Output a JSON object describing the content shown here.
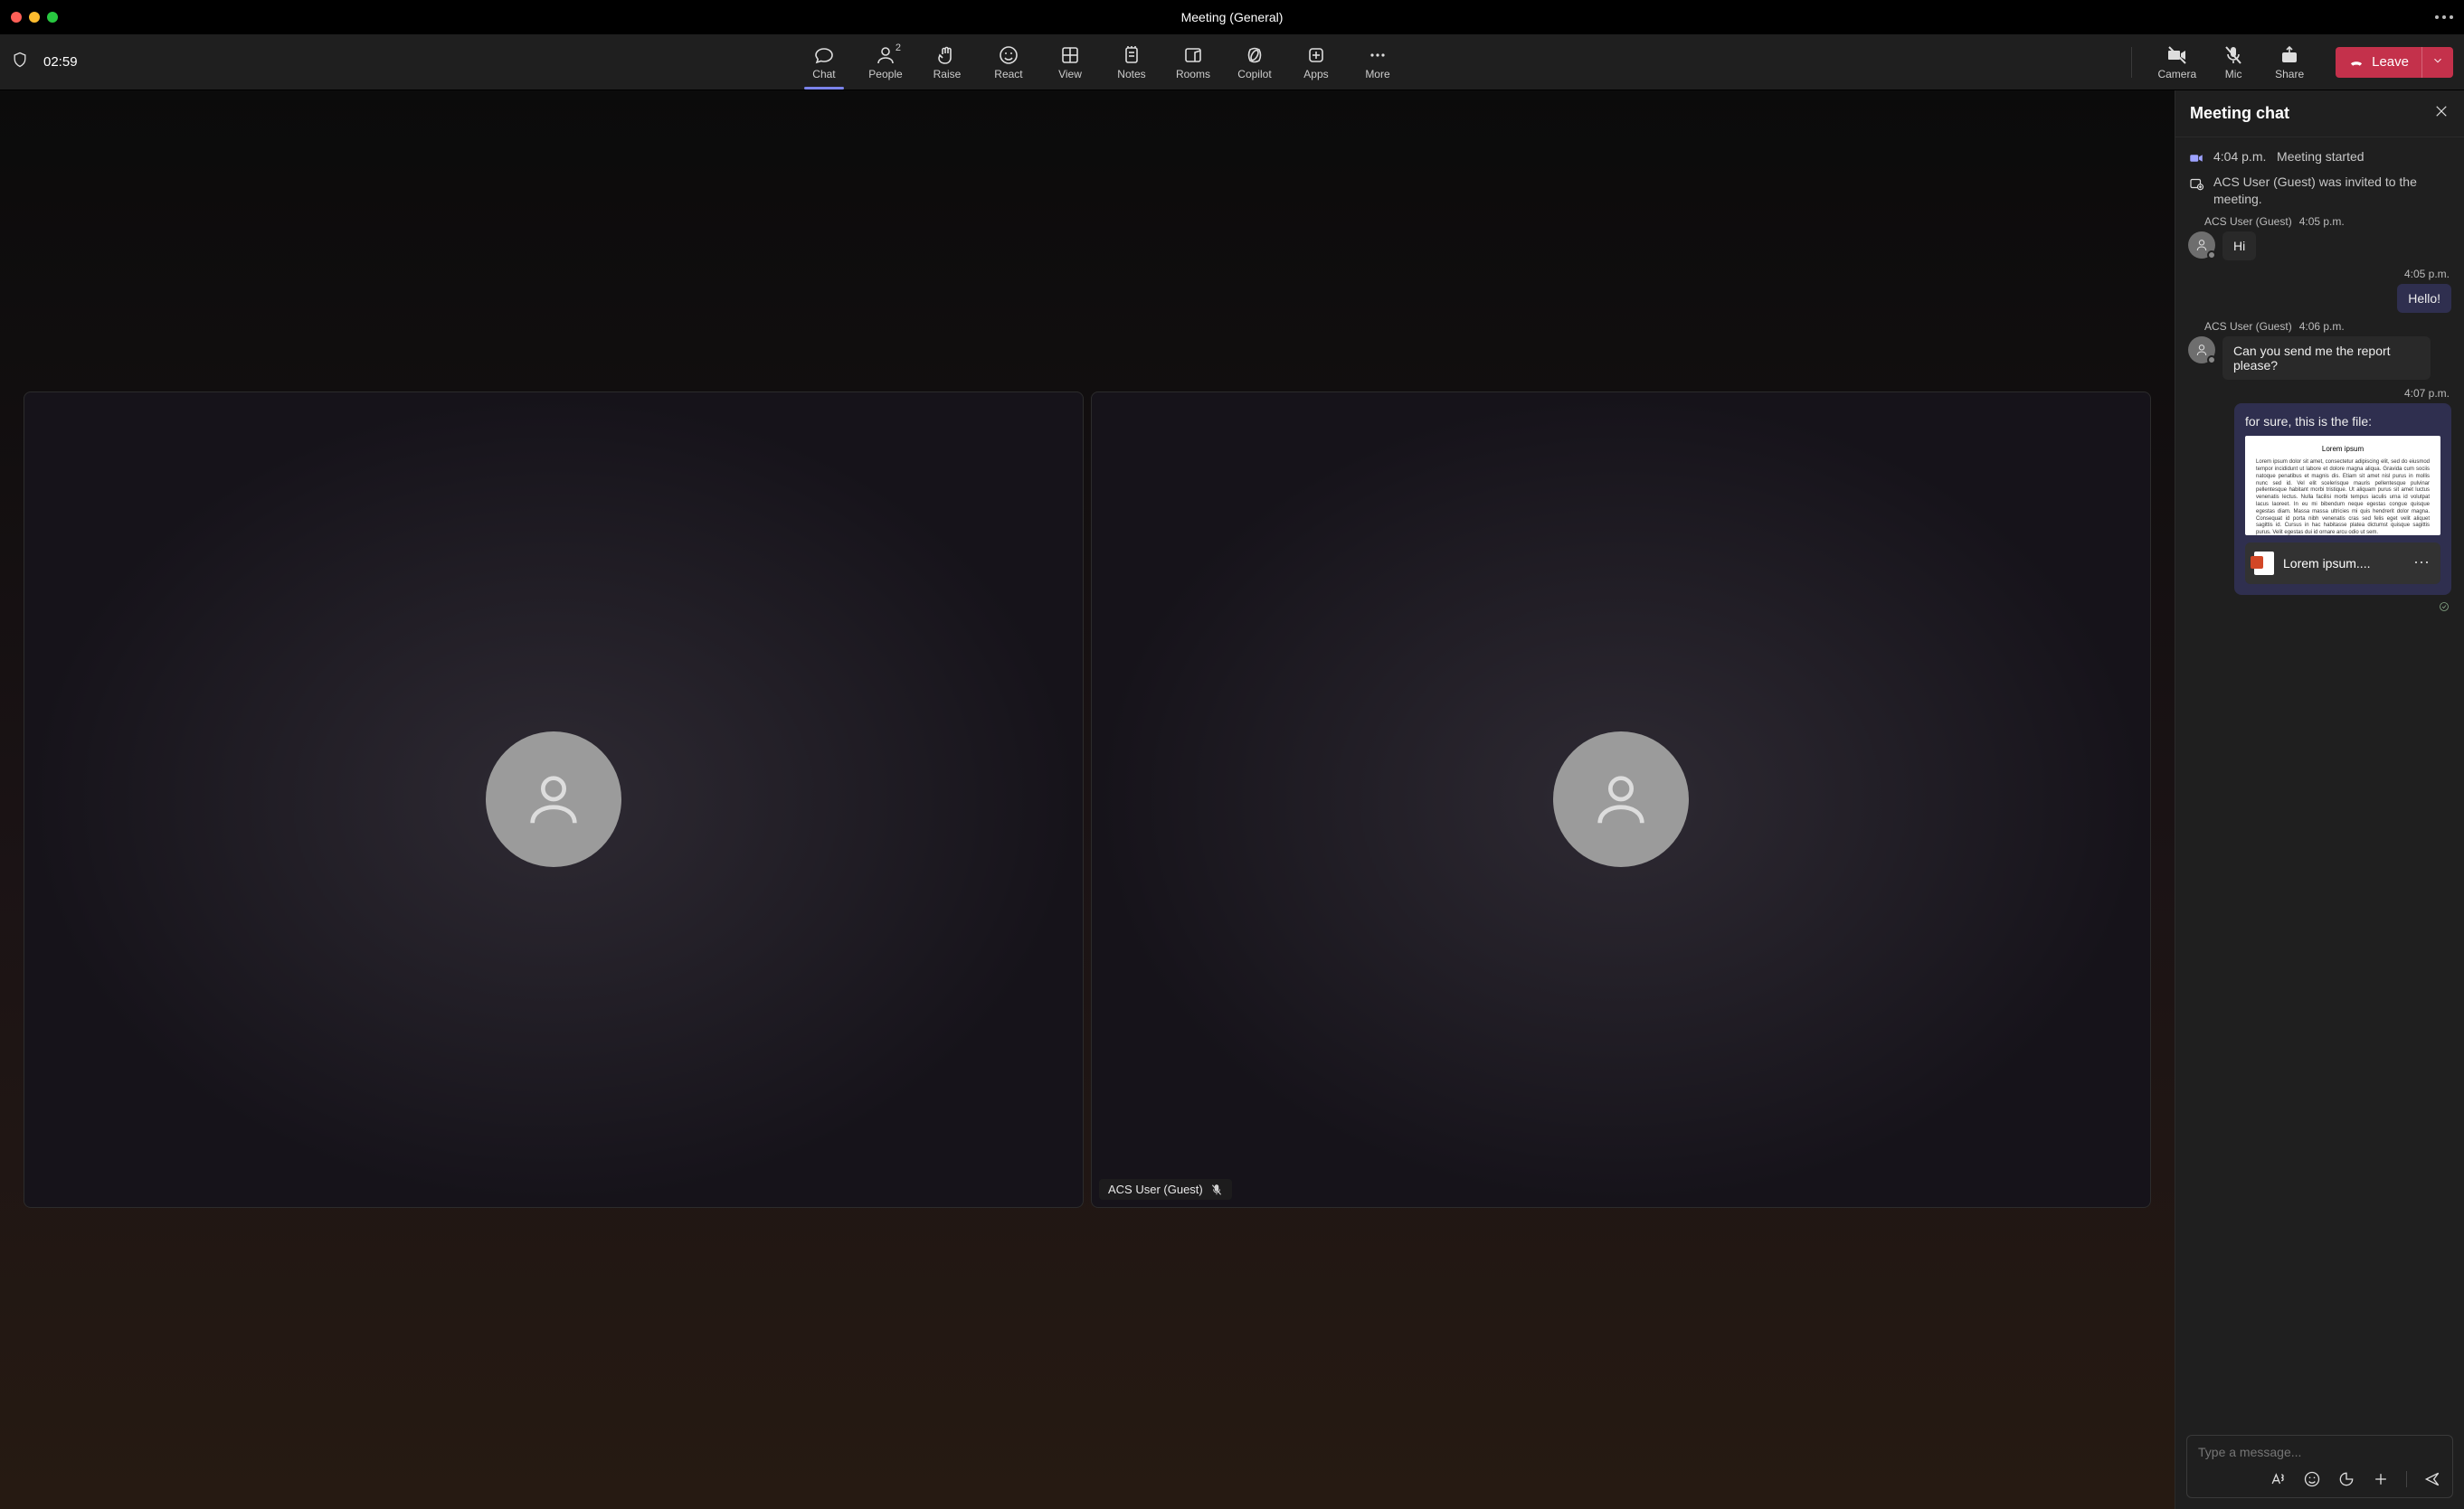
{
  "titlebar": {
    "title": "Meeting (General)"
  },
  "toolbar": {
    "timer": "02:59",
    "items": {
      "chat": "Chat",
      "people": "People",
      "people_count": "2",
      "raise": "Raise",
      "react": "React",
      "view": "View",
      "notes": "Notes",
      "rooms": "Rooms",
      "copilot": "Copilot",
      "apps": "Apps",
      "more": "More",
      "camera": "Camera",
      "mic": "Mic",
      "share": "Share"
    },
    "leave": "Leave"
  },
  "stage": {
    "participant2_name": "ACS User (Guest)"
  },
  "chat": {
    "title": "Meeting chat",
    "system_meeting_started_time": "4:04 p.m.",
    "system_meeting_started_text": "Meeting started",
    "system_invited_text": "ACS User (Guest) was invited to the meeting.",
    "msg1_sender": "ACS User (Guest)",
    "msg1_time": "4:05 p.m.",
    "msg1_text": "Hi",
    "msg2_time": "4:05 p.m.",
    "msg2_text": "Hello!",
    "msg3_sender": "ACS User (Guest)",
    "msg3_time": "4:06 p.m.",
    "msg3_text": "Can you send me the report please?",
    "msg4_time": "4:07 p.m.",
    "msg4_text": "for sure, this is the file:",
    "file_preview_title": "Lorem ipsum",
    "file_preview_body": "Lorem ipsum dolor sit amet, consectetur adipiscing elit, sed do eiusmod tempor incididunt ut labore et dolore magna aliqua. Gravida cum sociis natoque penatibus et magnis dis. Etiam sit amet nisl purus in mollis nunc sed id. Vel elit scelerisque mauris pellentesque pulvinar pellentesque habitant morbi tristique. Ut aliquam purus sit amet luctus venenatis lectus. Nulla facilisi morbi tempus iaculis urna id volutpat lacus laoreet. In eu mi bibendum neque egestas congue quisque egestas diam. Massa massa ultricies mi quis hendrerit dolor magna. Consequat id porta nibh venenatis cras sed felis eget velit aliquet sagittis id. Cursus in hac habitasse platea dictumst quisque sagittis purus. Velit egestas dui id ornare arcu odio ut sem.",
    "file_name": "Lorem ipsum....",
    "compose_placeholder": "Type a message..."
  }
}
